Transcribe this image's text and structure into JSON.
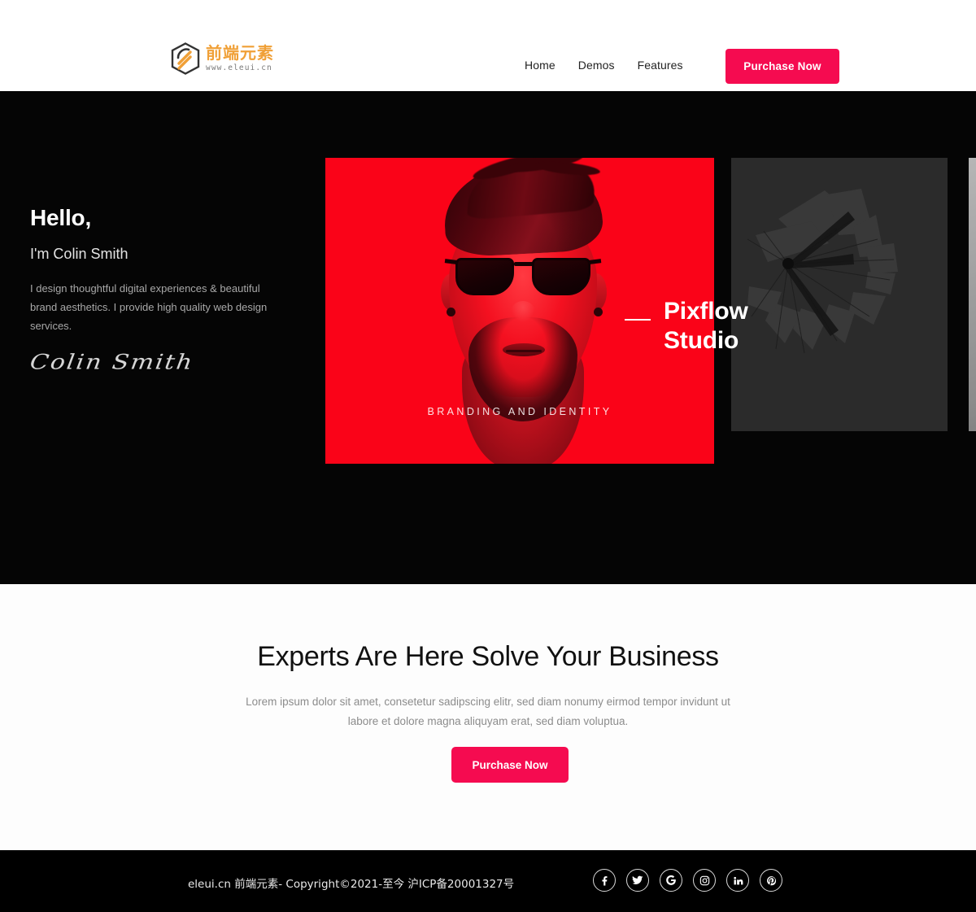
{
  "header": {
    "logo": {
      "icon": "hexagon-logo-icon",
      "cn_text": "前端元素",
      "url_text": "www.eleui.cn"
    },
    "nav": [
      {
        "label": "Home"
      },
      {
        "label": "Demos"
      },
      {
        "label": "Features"
      }
    ],
    "purchase_label": "Purchase Now"
  },
  "hero": {
    "greeting": "Hello,",
    "name_line": "I'm Colin Smith",
    "description": "I design thoughtful digital experiences & beautiful brand aesthetics. I provide high quality web design services.",
    "signature": "Colin Smith",
    "slider": {
      "overlay_title": "Pixflow\nStudio",
      "slides": [
        {
          "caption": "BRANDING AND IDENTITY",
          "kind": "red-portrait"
        },
        {
          "caption": "",
          "kind": "dark-burst"
        },
        {
          "caption": "",
          "kind": "gray-figure"
        }
      ]
    }
  },
  "cta": {
    "title": "Experts Are Here Solve Your Business",
    "subtitle": "Lorem ipsum dolor sit amet, consetetur sadipscing elitr, sed diam nonumy eirmod tempor invidunt ut labore et dolore magna aliquyam erat, sed diam voluptua.",
    "button_label": "Purchase Now"
  },
  "footer": {
    "copyright": "eleui.cn 前端元素- Copyright©2021-至今 沪ICP备20001327号",
    "socials": [
      {
        "name": "facebook-icon",
        "glyph": "f"
      },
      {
        "name": "twitter-icon",
        "glyph": "t"
      },
      {
        "name": "google-icon",
        "glyph": "G"
      },
      {
        "name": "instagram-icon",
        "glyph": "i"
      },
      {
        "name": "linkedin-icon",
        "glyph": "in"
      },
      {
        "name": "pinterest-icon",
        "glyph": "p"
      }
    ]
  },
  "colors": {
    "accent_pink": "#f50b50",
    "slide_red": "#fa0318",
    "hero_bg": "#050505",
    "logo_orange": "#f0a037"
  }
}
